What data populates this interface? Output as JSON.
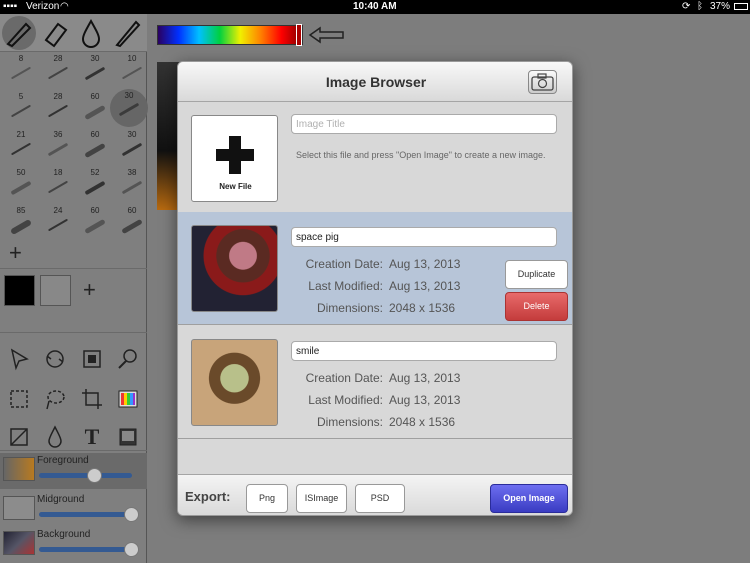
{
  "statusbar": {
    "carrier": "Verizon",
    "time": "10:40 AM",
    "battery": "37%"
  },
  "tools": [
    "pencil-tool",
    "eraser-tool",
    "smudge-tool",
    "brush-tool"
  ],
  "brushes": [
    {
      "size": "8"
    },
    {
      "size": "28"
    },
    {
      "size": "30"
    },
    {
      "size": "10"
    },
    {
      "size": "5"
    },
    {
      "size": "28"
    },
    {
      "size": "60"
    },
    {
      "size": "30"
    },
    {
      "size": "21"
    },
    {
      "size": "36"
    },
    {
      "size": "60"
    },
    {
      "size": "30"
    },
    {
      "size": "50"
    },
    {
      "size": "18"
    },
    {
      "size": "52"
    },
    {
      "size": "38"
    },
    {
      "size": "85"
    },
    {
      "size": "24"
    },
    {
      "size": "60"
    },
    {
      "size": "60"
    }
  ],
  "layers": [
    {
      "name": "Foreground",
      "level": 0.6
    },
    {
      "name": "Midground",
      "level": 1.0
    },
    {
      "name": "Background",
      "level": 1.0
    }
  ],
  "modal": {
    "title": "Image Browser",
    "new_file": {
      "label": "New File",
      "title_placeholder": "Image Title",
      "hint": "Select this file and press \"Open Image\" to create a new image."
    },
    "files": [
      {
        "title": "space pig",
        "creation_label": "Creation Date:",
        "creation": "Aug 13, 2013",
        "modified_label": "Last Modified:",
        "modified": "Aug 13, 2013",
        "dimensions_label": "Dimensions:",
        "dimensions": "2048 x 1536",
        "duplicate_label": "Duplicate",
        "delete_label": "Delete"
      },
      {
        "title": "smile",
        "creation_label": "Creation Date:",
        "creation": "Aug 13, 2013",
        "modified_label": "Last Modified:",
        "modified": "Aug 13, 2013",
        "dimensions_label": "Dimensions:",
        "dimensions": "2048 x 1536"
      }
    ],
    "footer": {
      "export_label": "Export:",
      "png": "Png",
      "isimage": "ISImage",
      "psd": "PSD",
      "open": "Open Image"
    }
  },
  "colors": {
    "accent_blue": "#4a4cd8",
    "delete_red": "#c43c3c",
    "selected_row": "#b7c5d8"
  }
}
